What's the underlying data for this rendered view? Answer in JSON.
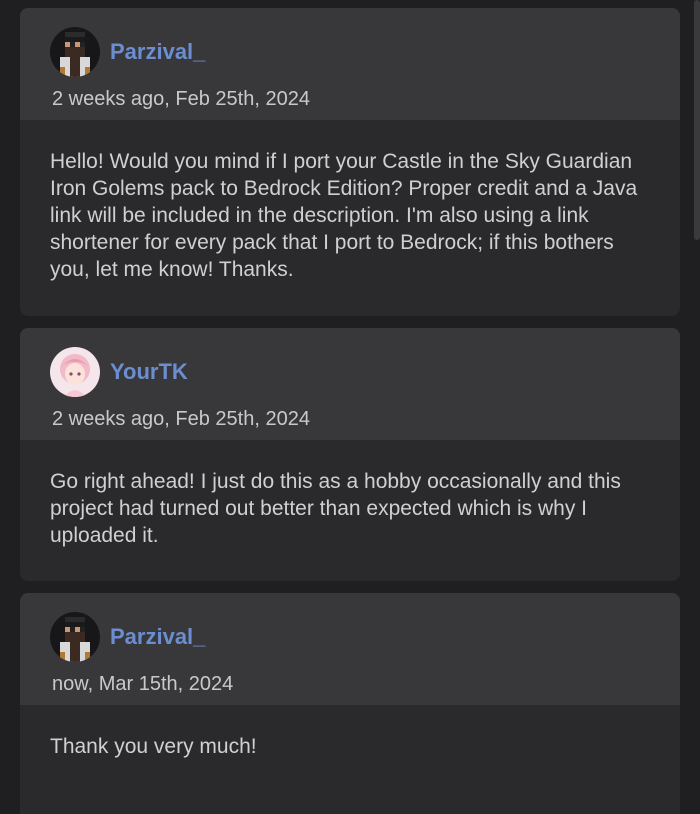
{
  "comments": [
    {
      "author": "Parzival_",
      "time": "2 weeks ago, Feb 25th, 2024",
      "avatar_icon": "pixel-bearded-man-avatar",
      "text": "Hello! Would you mind if I port your Castle in the Sky Guardian Iron Golems pack to Bedrock Edition? Proper credit and a Java link will be included in the description. I'm also using a link shortener for every pack that I port to Bedrock; if this bothers you, let me know! Thanks."
    },
    {
      "author": "YourTK",
      "time": "2 weeks ago, Feb 25th, 2024",
      "avatar_icon": "pink-anime-avatar",
      "text": "Go right ahead! I just do this as a hobby occasionally and this project had turned out better than expected which is why I uploaded it."
    },
    {
      "author": "Parzival_",
      "time": "now, Mar 15th, 2024",
      "avatar_icon": "pixel-bearded-man-avatar",
      "text": "Thank you very much!"
    }
  ],
  "colors": {
    "username": "#6c8ed0",
    "card_header": "#38383b",
    "card_body": "#2a2a2d",
    "background": "#1f1f21"
  }
}
